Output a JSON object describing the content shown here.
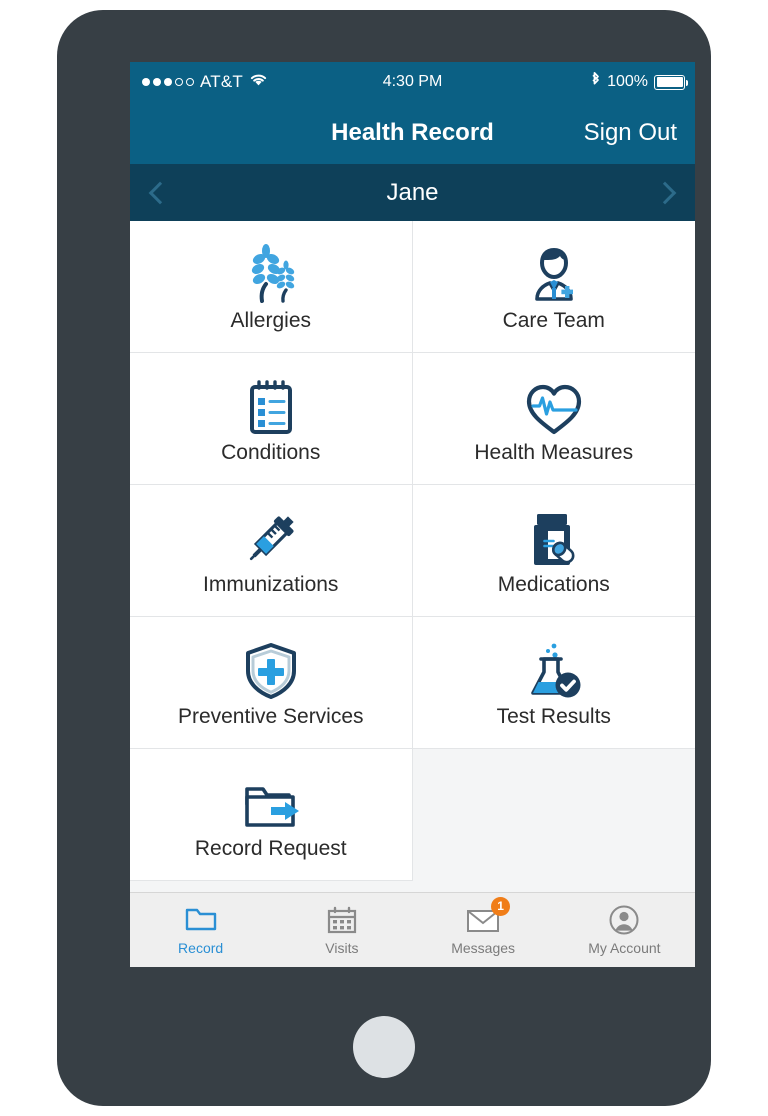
{
  "device": {
    "frame_color": "#373f45",
    "home_button": "home-button"
  },
  "statusbar": {
    "carrier": "AT&T",
    "signal_dots_filled": 3,
    "signal_dots_total": 5,
    "wifi_icon": "wifi-icon",
    "time": "4:30 PM",
    "bluetooth_icon": "bluetooth-icon",
    "battery_percent": "100%",
    "battery_icon": "battery-full-icon"
  },
  "navbar": {
    "title": "Health Record",
    "sign_out": "Sign Out",
    "background": "#0b6084"
  },
  "patientbar": {
    "name": "Jane",
    "prev_icon": "chevron-left-icon",
    "next_icon": "chevron-right-icon",
    "background": "#0e4059"
  },
  "grid": {
    "items": [
      {
        "label": "Allergies",
        "icon": "wheat-icon"
      },
      {
        "label": "Care Team",
        "icon": "doctor-icon"
      },
      {
        "label": "Conditions",
        "icon": "notepad-list-icon"
      },
      {
        "label": "Health Measures",
        "icon": "heart-pulse-icon"
      },
      {
        "label": "Immunizations",
        "icon": "syringe-icon"
      },
      {
        "label": "Medications",
        "icon": "pill-bottle-icon"
      },
      {
        "label": "Preventive Services",
        "icon": "shield-cross-icon"
      },
      {
        "label": "Test Results",
        "icon": "flask-check-icon"
      },
      {
        "label": "Record Request",
        "icon": "folder-arrow-icon"
      }
    ]
  },
  "tabbar": {
    "tabs": [
      {
        "label": "Record",
        "icon": "folder-icon",
        "active": true,
        "badge": ""
      },
      {
        "label": "Visits",
        "icon": "calendar-icon",
        "active": false,
        "badge": ""
      },
      {
        "label": "Messages",
        "icon": "envelope-icon",
        "active": false,
        "badge": "1"
      },
      {
        "label": "My Account",
        "icon": "avatar-icon",
        "active": false,
        "badge": ""
      }
    ]
  },
  "colors": {
    "brand_dark": "#1d3f5e",
    "brand_blue": "#2a8fd4",
    "light_blue": "#41a5e0",
    "badge_orange": "#f07d18",
    "active_tab": "#2a8fd4"
  }
}
